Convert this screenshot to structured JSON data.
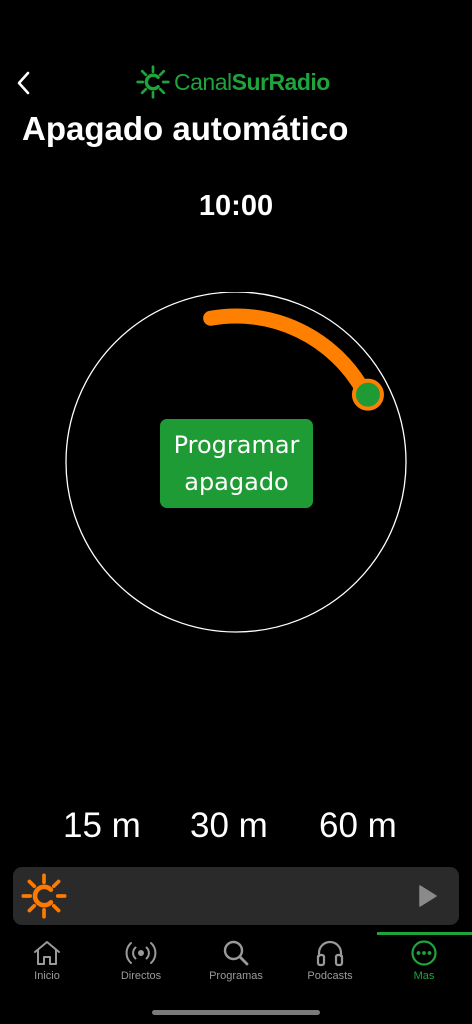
{
  "header": {
    "back_icon": "chevron-left-icon",
    "logo": {
      "icon": "sun-c-icon",
      "text_light": "Canal",
      "text_bold": "SurRadio",
      "color": "#1fa33b"
    }
  },
  "title": "Apagado automático",
  "timer": {
    "time": "10:00",
    "progress": 0.17,
    "arc_color": "#ff8000",
    "knob_color": "#1e9b34"
  },
  "program_button": {
    "line1": "Programar",
    "line2": "apagado",
    "color": "#1e9b34"
  },
  "presets": [
    "15 m",
    "30 m",
    "60 m"
  ],
  "player": {
    "logo_icon": "sun-c-icon",
    "logo_color": "#ff7a00",
    "play_icon": "play-icon"
  },
  "tabs": [
    {
      "label": "Inicio",
      "icon": "home-icon",
      "active": false
    },
    {
      "label": "Directos",
      "icon": "broadcast-icon",
      "active": false
    },
    {
      "label": "Programas",
      "icon": "search-icon",
      "active": false
    },
    {
      "label": "Podcasts",
      "icon": "headphones-icon",
      "active": false
    },
    {
      "label": "Mas",
      "icon": "more-icon",
      "active": true
    }
  ],
  "accent_color": "#1fa33b"
}
